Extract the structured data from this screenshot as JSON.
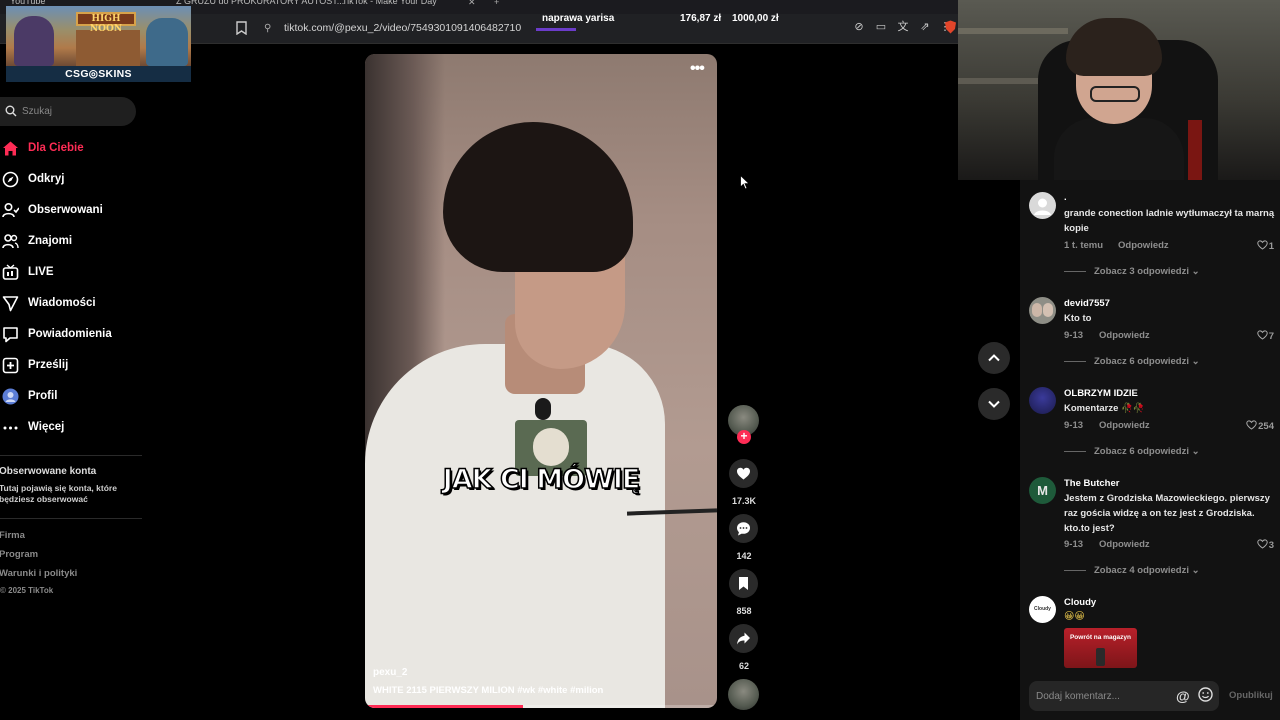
{
  "browser": {
    "tabs": [
      "YouTube",
      "Z GRUZU do PROKURATORY AUTOST...",
      "TikTok - Make Your Day"
    ],
    "url": "tiktok.com/@pexu_2/video/7549301091406482710"
  },
  "stream_overlay": {
    "game_sign": "HIGH NOON",
    "sponsor": "CSG◎SKINS",
    "donation_goal_name": "naprawa yarisa",
    "donation_current": "176,87 zł",
    "donation_target": "1000,00 zł"
  },
  "sidebar": {
    "search_placeholder": "Szukaj",
    "nav": [
      {
        "label": "Dla Ciebie",
        "icon": "home-icon",
        "active": true
      },
      {
        "label": "Odkryj",
        "icon": "compass-icon"
      },
      {
        "label": "Obserwowani",
        "icon": "following-icon"
      },
      {
        "label": "Znajomi",
        "icon": "friends-icon"
      },
      {
        "label": "LIVE",
        "icon": "live-icon"
      },
      {
        "label": "Wiadomości",
        "icon": "messages-icon"
      },
      {
        "label": "Powiadomienia",
        "icon": "notifications-icon"
      },
      {
        "label": "Prześlij",
        "icon": "upload-icon"
      },
      {
        "label": "Profil",
        "icon": "profile-icon"
      },
      {
        "label": "Więcej",
        "icon": "more-icon"
      }
    ],
    "followed_title": "Obserwowane konta",
    "followed_desc": "Tutaj pojawią się konta, które będziesz obserwować",
    "footer": [
      "Firma",
      "Program",
      "Warunki i polityki"
    ],
    "copyright": "© 2025 TikTok"
  },
  "video": {
    "caption_overlay": "JAK CI MÓWIĘ",
    "author": "pexu_2",
    "description": "WHITE 2115 PIERWSZY MILION #wk  #white  #milion",
    "progress": 0.45,
    "likes": "17.3K",
    "comments": "142",
    "saves": "858",
    "shares": "62"
  },
  "comments": {
    "items": [
      {
        "user": ".",
        "text": "grande conection ladnie wytłumaczył ta marną kopie",
        "time": "1 t. temu",
        "reply": "Odpowiedz",
        "likes": "1",
        "more": "Zobacz 3 odpowiedzi",
        "avatar_color": "#d9d9d9"
      },
      {
        "user": "devid7557",
        "text": "Kto to",
        "time": "9-13",
        "reply": "Odpowiedz",
        "likes": "7",
        "more": "Zobacz 6 odpowiedzi",
        "avatar_color": "#8e8e86"
      },
      {
        "user": "OLBRZYM IDZIE",
        "text": "Komentarze 🥀🥀",
        "time": "9-13",
        "reply": "Odpowiedz",
        "likes": "254",
        "more": "Zobacz 6 odpowiedzi",
        "avatar_color": "#2b2a6a"
      },
      {
        "user": "The Butcher",
        "text": "Jestem z Grodziska Mazowieckiego. pierwszy raz gościa widzę a on tez jest z Grodziska. kto.to jest?",
        "time": "9-13",
        "reply": "Odpowiedz",
        "likes": "3",
        "more": "Zobacz 4 odpowiedzi",
        "avatar_letter": "M",
        "avatar_color": "#1e5a3a"
      },
      {
        "user": "Cloudy",
        "emoji": "😀😀",
        "image_text": "Powrót na magazyn",
        "avatar_color": "#ffffff",
        "avatar_text": "Cloudy"
      }
    ],
    "input_placeholder": "Dodaj komentarz...",
    "publish_label": "Opublikuj"
  }
}
